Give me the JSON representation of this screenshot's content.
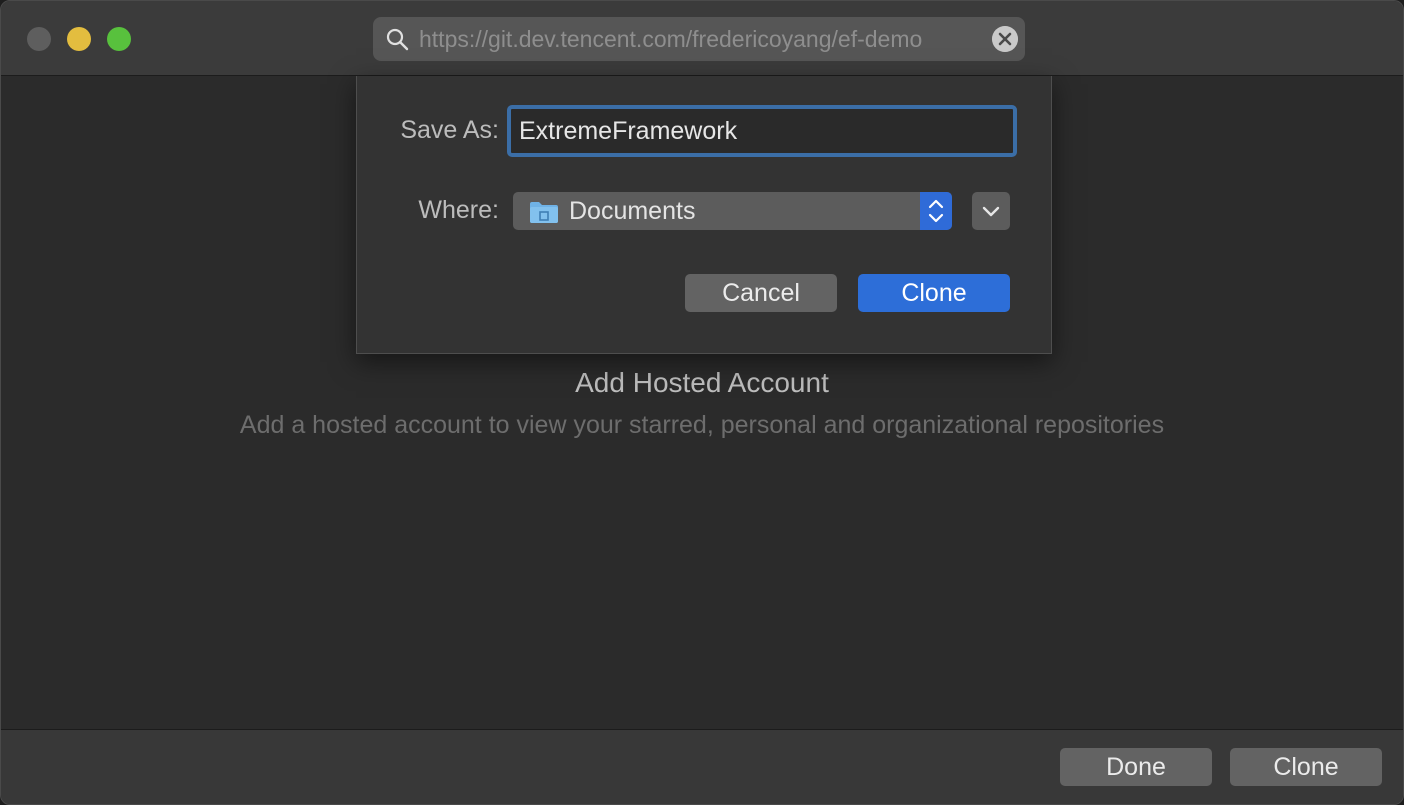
{
  "window": {
    "traffic_lights": {
      "close_color": "#5e5e5e",
      "minimize_color": "#e3bd3f",
      "zoom_color": "#58c13d"
    },
    "url_bar": {
      "icon": "search-icon",
      "value": "https://git.dev.tencent.com/fredericoyang/ef-demo",
      "clear_icon": "clear-icon"
    }
  },
  "sheet": {
    "save_as_label": "Save As:",
    "save_as_value": "ExtremeFramework",
    "where_label": "Where:",
    "where_value": "Documents",
    "where_icon": "folder-icon",
    "cancel_label": "Cancel",
    "clone_label": "Clone"
  },
  "empty_state": {
    "title": "Add Hosted Account",
    "subtitle": "Add a hosted account to view your starred, personal and organizational repositories"
  },
  "footer": {
    "done_label": "Done",
    "clone_label": "Clone"
  },
  "colors": {
    "accent": "#2d6ed8",
    "focus_ring": "#3b6ea7"
  }
}
